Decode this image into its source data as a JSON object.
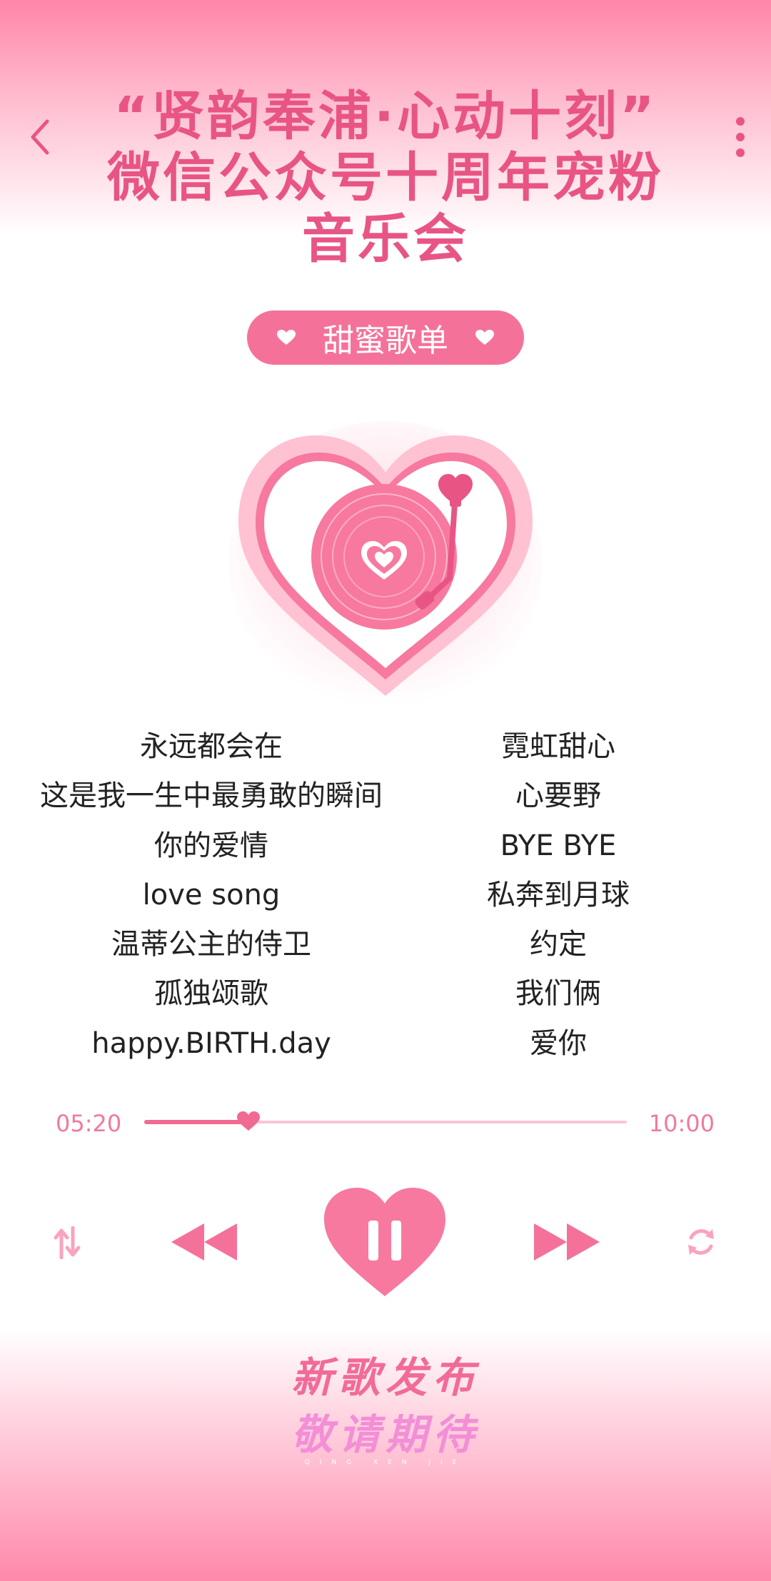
{
  "header": {
    "title_lines": [
      "“贤韵奉浦·心动十刻”",
      "微信公众号十周年宠粉",
      "音乐会"
    ]
  },
  "playlist": {
    "label": "甜蜜歌单",
    "songs_left": [
      "永远都会在",
      "这是我一生中最勇敢的瞬间",
      "你的爱情",
      "love song",
      "温蒂公主的侍卫",
      "孤独颂歌",
      "happy.BIRTH.day"
    ],
    "songs_right": [
      "霓虹甜心",
      "心要野",
      "BYE BYE",
      "私奔到月球",
      "约定",
      "我们俩",
      "爱你"
    ]
  },
  "player": {
    "current_time": "05:20",
    "total_time": "10:00",
    "progress": 0.216,
    "state": "playing"
  },
  "promo": {
    "line1": "新歌发布",
    "line2": "敬请期待",
    "subtitle": "QING  XEN  JIE"
  },
  "icons": {
    "back": "chevron-left-icon",
    "menu": "more-vertical-icon",
    "shuffle": "shuffle-icon",
    "prev": "rewind-icon",
    "play_pause": "pause-heart-icon",
    "next": "fast-forward-icon",
    "repeat": "repeat-icon"
  },
  "colors": {
    "accent": "#f06a93",
    "title": "#e85585",
    "track": "#f9c6d6"
  }
}
